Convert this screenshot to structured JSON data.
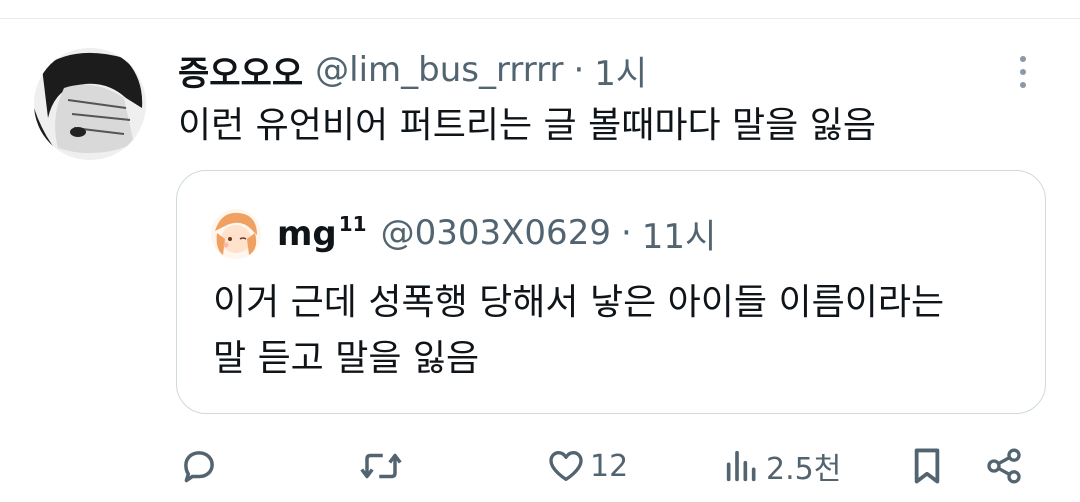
{
  "tweet": {
    "display_name": "증오오오",
    "handle": "@lim_bus_rrrrr",
    "separator": "·",
    "time": "1시",
    "text": "이런 유언비어 퍼트리는 글 볼때마다 말을 잃음",
    "avatar_icon": "avatar-illustration-bandaged-face"
  },
  "quote": {
    "display_name": "mg",
    "name_superscript": "11",
    "handle": "@0303X0629",
    "separator": "·",
    "time": "11시",
    "text_line1": "이거 근데 성폭행 당해서 낳은 아이들 이름이라는",
    "text_line2": "말 듣고 말을 잃음",
    "avatar_icon": "avatar-illustration-orange-hair"
  },
  "actions": {
    "reply_icon": "reply-icon",
    "retweet_icon": "retweet-icon",
    "like_icon": "heart-icon",
    "like_count": "12",
    "views_icon": "views-icon",
    "views_count": "2.5천",
    "bookmark_icon": "bookmark-icon",
    "share_icon": "share-icon"
  },
  "colors": {
    "text": "#0f1419",
    "secondary": "#536471",
    "border": "#cfd9de"
  }
}
